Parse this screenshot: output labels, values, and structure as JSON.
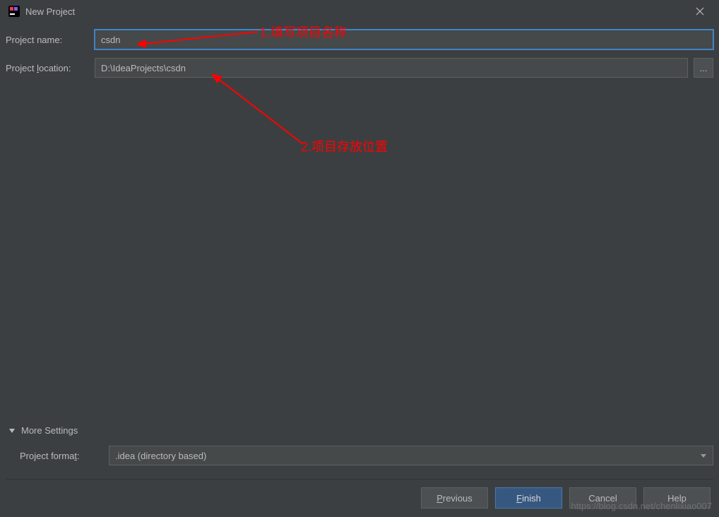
{
  "titlebar": {
    "title": "New Project"
  },
  "form": {
    "project_name_label": "Project name:",
    "project_name_value": "csdn",
    "project_location_label_prefix": "Project ",
    "project_location_mnemonic": "l",
    "project_location_label_suffix": "ocation:",
    "project_location_value": "D:\\IdeaProjects\\csdn",
    "browse_label": "..."
  },
  "more_settings": {
    "header": "More Settings",
    "project_format_label_prefix": "Project forma",
    "project_format_mnemonic": "t",
    "project_format_label_suffix": ":",
    "project_format_value": ".idea (directory based)"
  },
  "buttons": {
    "previous_mnemonic": "P",
    "previous_suffix": "revious",
    "finish_mnemonic": "F",
    "finish_suffix": "inish",
    "cancel": "Cancel",
    "help": "Help"
  },
  "annotations": {
    "note1": "1.填写项目名称",
    "note2": "2.项目存放位置"
  },
  "watermark": "https://blog.csdn.net/chenlixiao007"
}
